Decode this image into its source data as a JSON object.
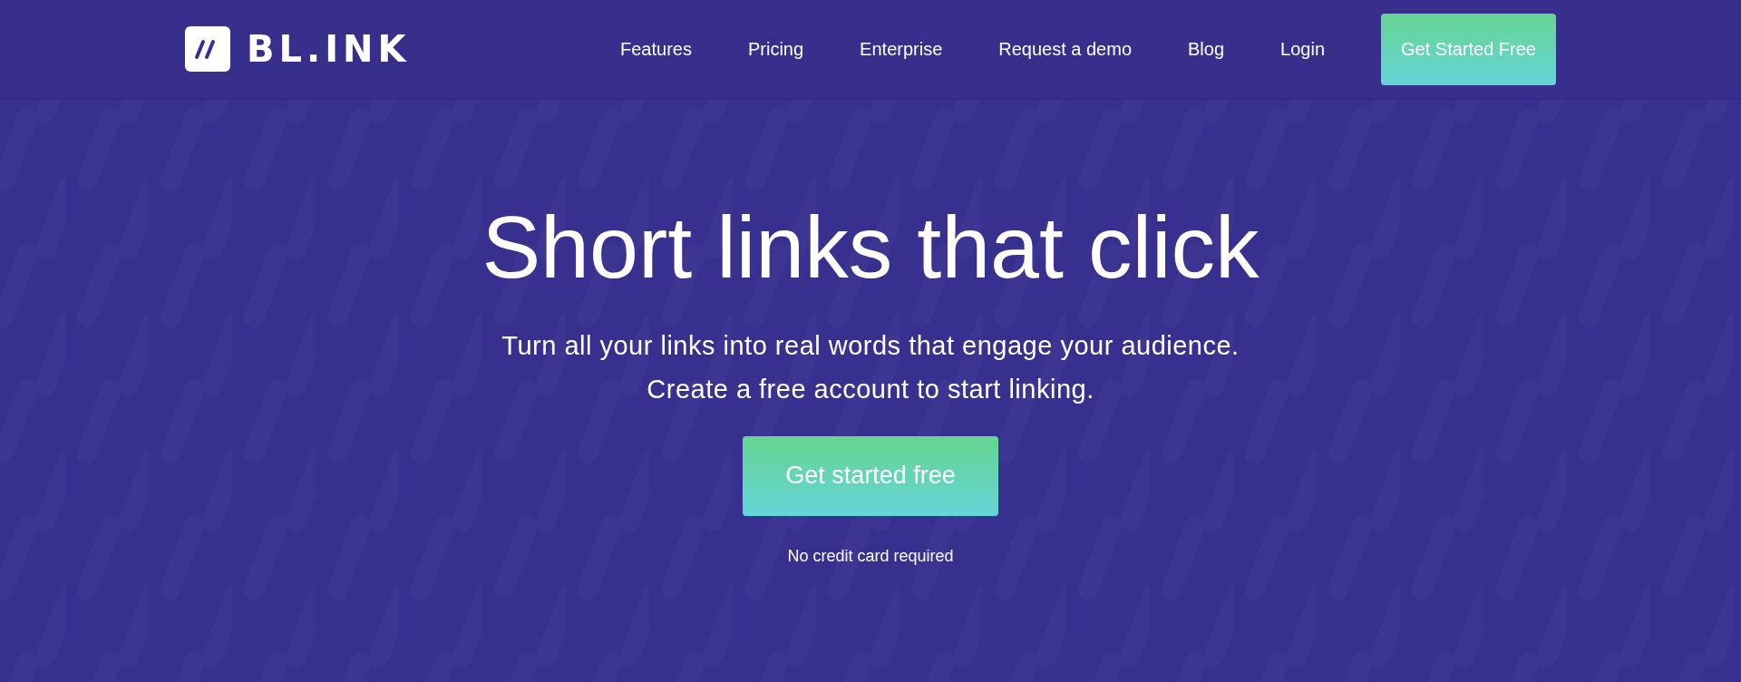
{
  "header": {
    "logo_text": "BL.INK",
    "nav": [
      {
        "label": "Features"
      },
      {
        "label": "Pricing"
      },
      {
        "label": "Enterprise"
      },
      {
        "label": "Request a demo"
      },
      {
        "label": "Blog"
      },
      {
        "label": "Login"
      }
    ],
    "cta": "Get Started Free"
  },
  "hero": {
    "title": "Short links that click",
    "subtitle_lines": [
      "Turn all your links into real words that engage your audience.",
      "Create a free account to start linking."
    ],
    "button": "Get started free",
    "note": "No credit card required"
  }
}
